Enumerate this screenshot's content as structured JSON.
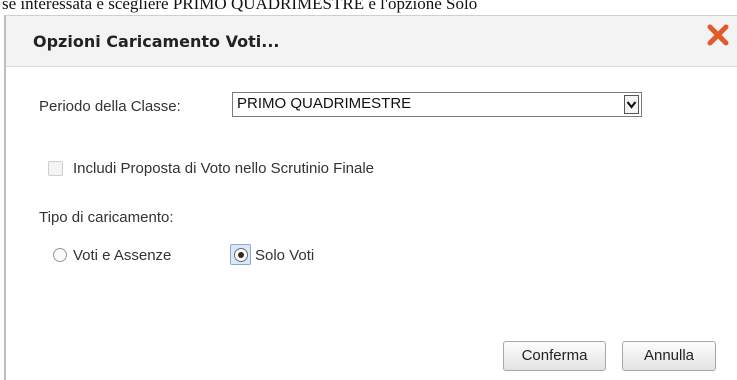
{
  "background": {
    "text": "se interessata e scegliere PRIMO QUADRIMESTRE e l'opzione Solo"
  },
  "dialog": {
    "title": "Opzioni Caricamento Voti...",
    "close_icon": "close-x-icon",
    "close_color": "#e05a2a"
  },
  "period": {
    "label": "Periodo della Classe:",
    "selected": "PRIMO QUADRIMESTRE"
  },
  "include_proposal": {
    "label": "Includi Proposta di Voto nello Scrutinio Finale",
    "checked": false,
    "enabled": false
  },
  "load_type": {
    "label": "Tipo di caricamento:",
    "options": [
      {
        "label": "Voti e Assenze",
        "selected": false
      },
      {
        "label": "Solo Voti",
        "selected": true
      }
    ]
  },
  "buttons": {
    "confirm": "Conferma",
    "cancel": "Annulla"
  }
}
